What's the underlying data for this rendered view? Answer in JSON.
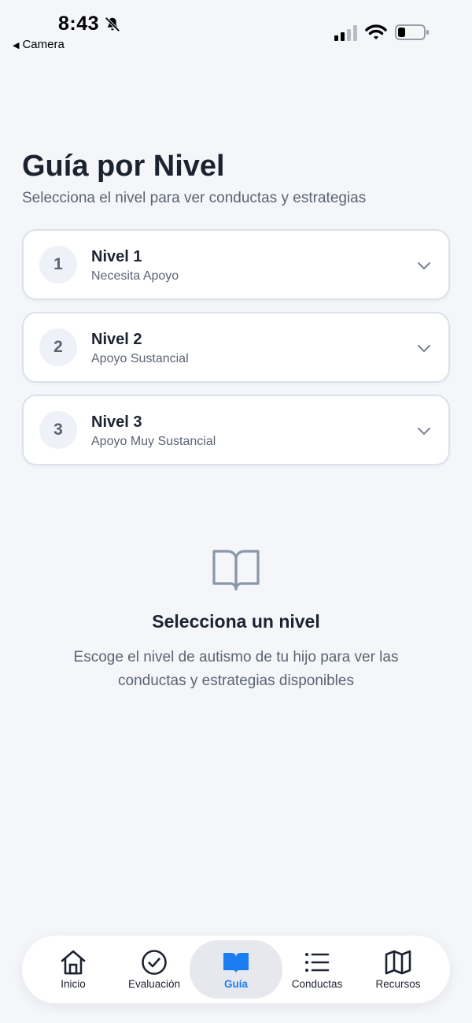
{
  "status_bar": {
    "time": "8:43",
    "back_label": "Camera",
    "icons": [
      "bell-slash-icon",
      "cellular-signal-icon",
      "wifi-icon",
      "battery-icon"
    ]
  },
  "header": {
    "title": "Guía por Nivel",
    "subtitle": "Selecciona el nivel para ver conductas y estrategias"
  },
  "levels": [
    {
      "number": "1",
      "name": "Nivel 1",
      "description": "Necesita Apoyo"
    },
    {
      "number": "2",
      "name": "Nivel 2",
      "description": "Apoyo Sustancial"
    },
    {
      "number": "3",
      "name": "Nivel 3",
      "description": "Apoyo Muy Sustancial"
    }
  ],
  "empty_state": {
    "icon": "open-book-icon",
    "title": "Selecciona un nivel",
    "text": "Escoge el nivel de autismo de tu hijo para ver las conductas y estrategias disponibles"
  },
  "bottom_nav": {
    "items": [
      {
        "label": "Inicio",
        "icon": "home-icon",
        "active": false
      },
      {
        "label": "Evaluación",
        "icon": "check-circle-icon",
        "active": false
      },
      {
        "label": "Guía",
        "icon": "book-icon",
        "active": true
      },
      {
        "label": "Conductas",
        "icon": "list-icon",
        "active": false
      },
      {
        "label": "Recursos",
        "icon": "map-icon",
        "active": false
      }
    ]
  },
  "colors": {
    "background": "#f4f6fa",
    "accent": "#1a7ef2",
    "text_primary": "#1c2330",
    "text_secondary": "#5b6472",
    "card_border": "#dbe1ea"
  }
}
